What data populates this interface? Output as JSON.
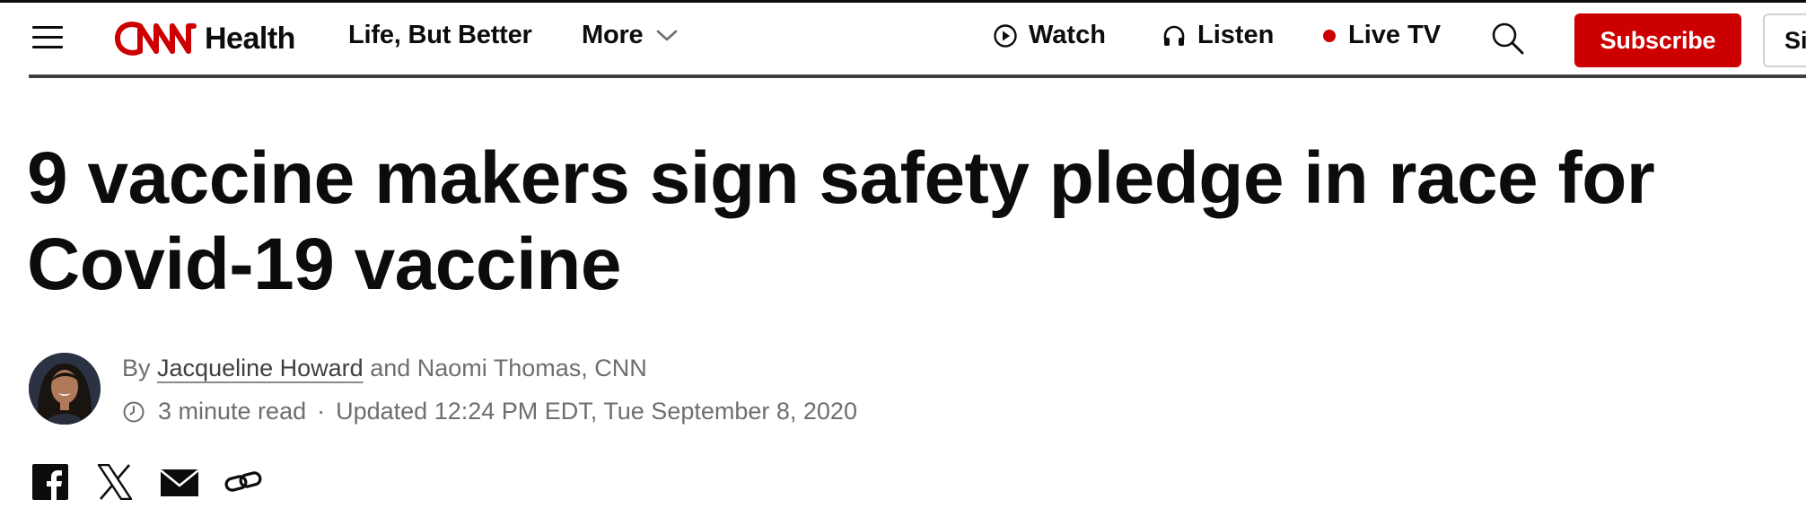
{
  "header": {
    "logo_brand": "CNN",
    "section": "Health",
    "nav": {
      "life_but_better": "Life, But Better",
      "more": "More"
    },
    "utilities": {
      "watch": "Watch",
      "listen": "Listen",
      "live_tv": "Live TV"
    },
    "subscribe_label": "Subscribe",
    "signin_label": "Sign in"
  },
  "article": {
    "headline_line1": "9 vaccine makers sign safety pledge in race for",
    "headline_line2": "Covid-19 vaccine",
    "byline_prefix": "By",
    "author_primary": "Jacqueline Howard",
    "byline_rest": "and Naomi Thomas, CNN",
    "read_time": "3 minute read",
    "separator": "·",
    "updated": "Updated 12:24 PM EDT, Tue September 8, 2020"
  },
  "share": {
    "icons": [
      "facebook-icon",
      "x-icon",
      "email-icon",
      "link-icon"
    ]
  },
  "colors": {
    "brand_red": "#cc0000",
    "text": "#0c0c0c",
    "meta_gray": "#6e6e6e"
  }
}
